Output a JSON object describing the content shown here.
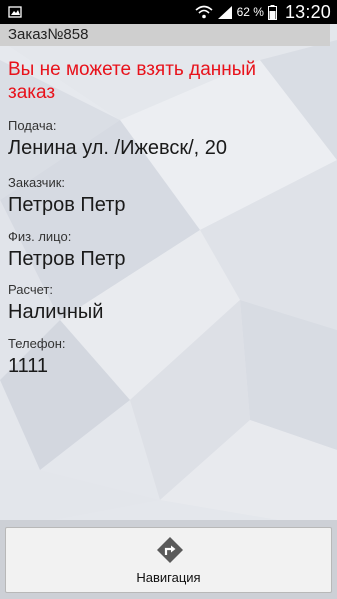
{
  "status_bar": {
    "battery_percent": "62 %",
    "time": "13:20"
  },
  "order": {
    "title": "Заказ№858",
    "warning": "Вы не можете взять данный заказ"
  },
  "fields": [
    {
      "label": "Подача:",
      "value": "Ленина ул. /Ижевск/, 20"
    },
    {
      "label": "Заказчик:",
      "value": "Петров Петр"
    },
    {
      "label": "Физ. лицо:",
      "value": "Петров Петр"
    },
    {
      "label": "Расчет:",
      "value": "Наличный"
    },
    {
      "label": "Телефон:",
      "value": "1111"
    }
  ],
  "navigation": {
    "label": "Навигация",
    "icon": "turn-right-icon"
  },
  "colors": {
    "warning": "#e8121b",
    "header_bg": "#cfcfcf",
    "status_bar_bg": "#000000"
  }
}
